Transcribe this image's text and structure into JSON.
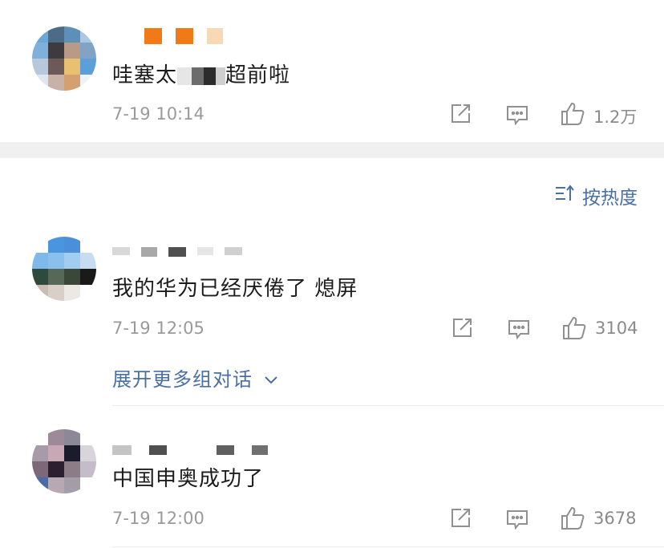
{
  "comments": [
    {
      "text": "哇塞太",
      "text_tail": "超前啦",
      "time": "7-19 10:14",
      "likes": "1.2万"
    },
    {
      "text": "我的华为已经厌倦了 熄屏",
      "time": "7-19 12:05",
      "likes": "3104",
      "expand_label": "展开更多组对话"
    },
    {
      "text": "中国申奥成功了",
      "time": "7-19 12:00",
      "likes": "3678"
    }
  ],
  "sort": {
    "label": "按热度"
  },
  "icons": {
    "share": "share-icon",
    "comment": "comment-icon",
    "like": "thumbs-up-icon",
    "sort": "sort-icon",
    "chevron": "chevron-down-icon"
  },
  "colors": {
    "link": "#4a6fa5",
    "divider": "#f0f0f0",
    "text": "#1c1c1c",
    "muted": "#9a9a9a"
  }
}
